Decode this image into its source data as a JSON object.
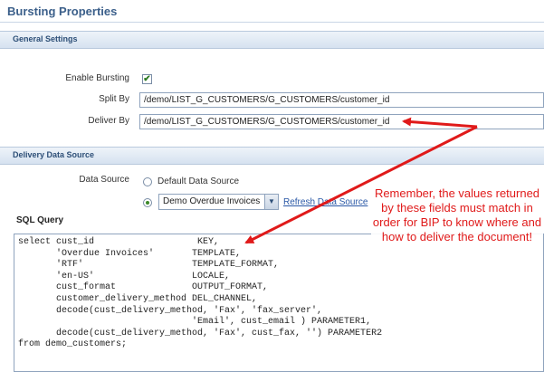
{
  "page": {
    "title": "Bursting Properties"
  },
  "general_settings": {
    "header": "General Settings",
    "enable_bursting_label": "Enable Bursting",
    "enable_bursting_checked": true,
    "split_by_label": "Split By",
    "split_by_value": "/demo/LIST_G_CUSTOMERS/G_CUSTOMERS/customer_id",
    "deliver_by_label": "Deliver By",
    "deliver_by_value": "/demo/LIST_G_CUSTOMERS/G_CUSTOMERS/customer_id"
  },
  "delivery_data_source": {
    "header": "Delivery Data Source",
    "data_source_label": "Data Source",
    "default_option_label": "Default Data Source",
    "selected_data_source": "Demo Overdue Invoices",
    "refresh_link": "Refresh Data Source"
  },
  "sql": {
    "label": "SQL Query",
    "query": "select cust_id                   KEY,\n       'Overdue Invoices'       TEMPLATE,\n       'RTF'                    TEMPLATE_FORMAT,\n       'en-US'                  LOCALE,\n       cust_format              OUTPUT_FORMAT,\n       customer_delivery_method DEL_CHANNEL,\n       decode(cust_delivery_method, 'Fax', 'fax_server',\n                                'Email', cust_email ) PARAMETER1,\n       decode(cust_delivery_method, 'Fax', cust_fax, '') PARAMETER2\nfrom demo_customers;"
  },
  "annotation": {
    "text": "Remember, the values returned by these fields must match in order for BIP to know where and how to deliver the document!",
    "color": "#e01a1a"
  },
  "icons": {
    "checkmark": "✔",
    "dropdown": "▼"
  }
}
